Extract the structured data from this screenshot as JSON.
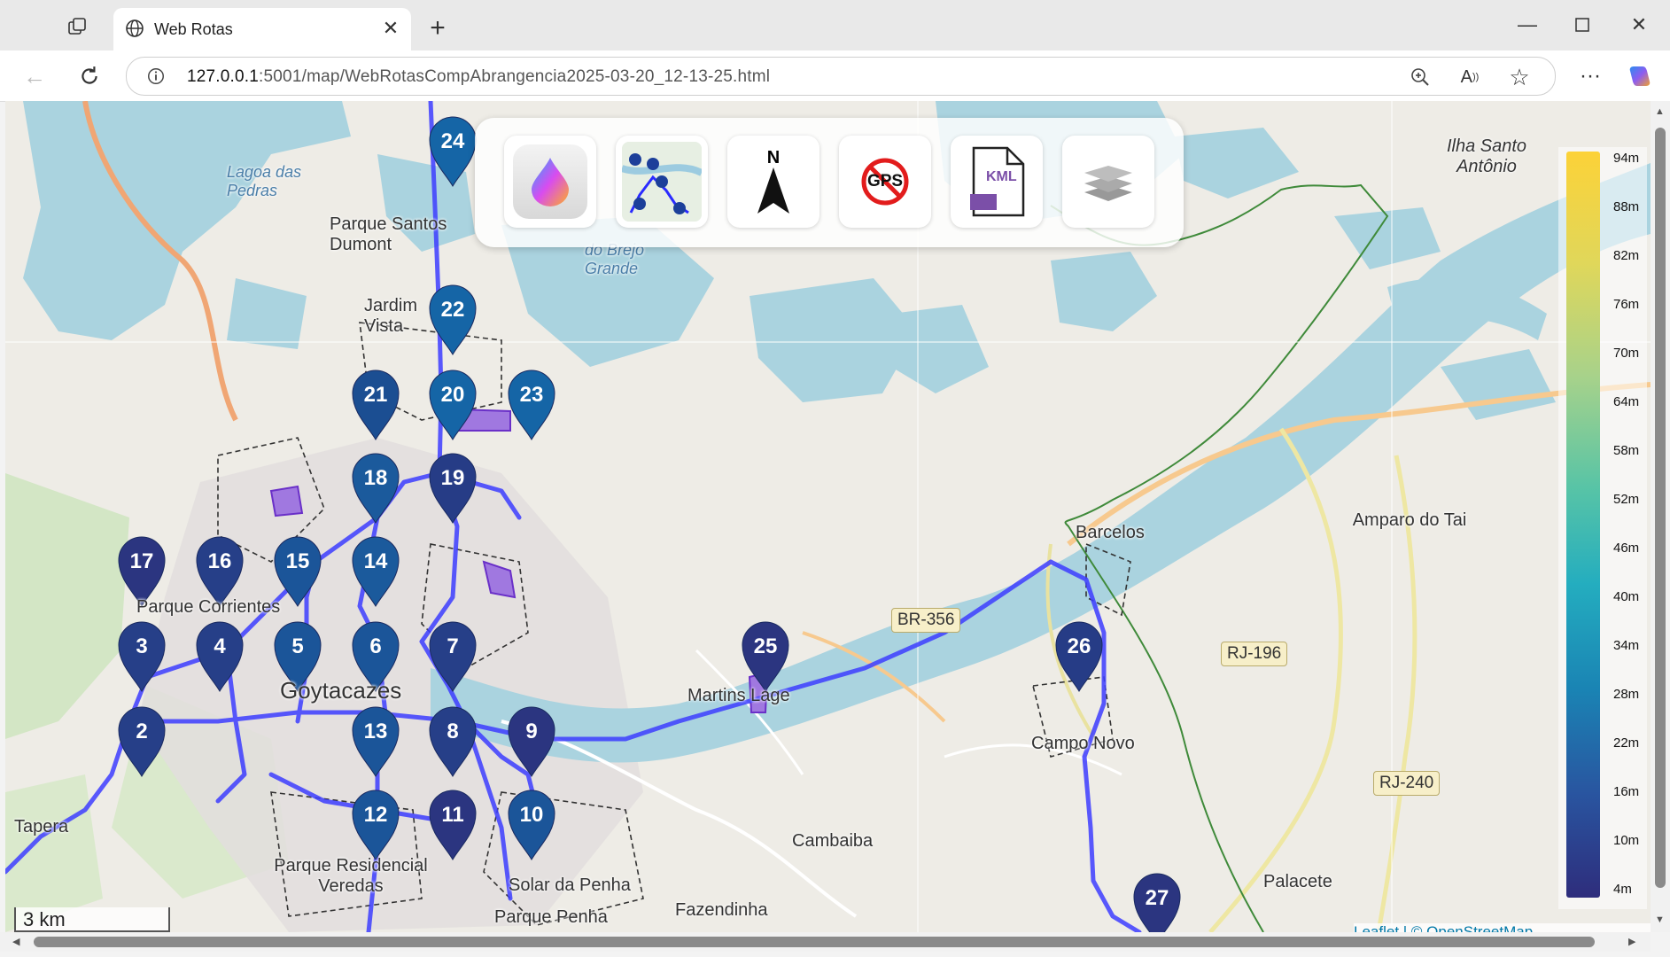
{
  "browser": {
    "tab_title": "Web Rotas",
    "url_host": "127.0.0.1",
    "url_rest": ":5001/map/WebRotasCompAbrangencia2025-03-20_12-13-25.html"
  },
  "map": {
    "controls": [
      "elevation-palette",
      "route-map",
      "north-arrow",
      "gps-off",
      "kml-export",
      "layers"
    ],
    "kml_icon_text": "KML",
    "north_letter": "N",
    "gps_text": "GPS",
    "scale_label": "3 km",
    "attribution": "Leaflet | © OpenStreetMap",
    "legend_labels": [
      "94m",
      "88m",
      "82m",
      "76m",
      "70m",
      "64m",
      "58m",
      "52m",
      "46m",
      "40m",
      "34m",
      "28m",
      "22m",
      "16m",
      "10m",
      "4m"
    ],
    "places": {
      "lagoa_das_pedras": "Lagoa das Pedras",
      "parque_santos_dumont": "Parque Santos Dumont",
      "jardim_vista": "Jardim Vista",
      "brejo_grande": "do Brejo Grande",
      "ilha_santo_antonio": "Ilha Santo Antônio",
      "barcelos": "Barcelos",
      "amparo_do_tai": "Amparo do Tai",
      "martins_lage": "Martins Lage",
      "campo_novo": "Campo Novo",
      "cambaiba": "Cambaiba",
      "palacete": "Palacete",
      "fazendinha": "Fazendinha",
      "parque_penha": "Parque Penha",
      "solar_da_penha": "Solar da Penha",
      "parque_residencial_veredas": "Parque Residencial Veredas",
      "goytacazes": "Goytacazes",
      "parque_corrientes": "Parque Corrientes",
      "tapera": "Tapera",
      "br356": "BR-356",
      "rj196": "RJ-196",
      "rj240": "RJ-240"
    },
    "markers": [
      {
        "n": "24",
        "color": "#1565a6"
      },
      {
        "n": "22",
        "color": "#1565a6"
      },
      {
        "n": "21",
        "color": "#1b4e92"
      },
      {
        "n": "20",
        "color": "#1565a6"
      },
      {
        "n": "23",
        "color": "#1565a6"
      },
      {
        "n": "18",
        "color": "#1b5a9c"
      },
      {
        "n": "19",
        "color": "#263c86"
      },
      {
        "n": "17",
        "color": "#2b3580"
      },
      {
        "n": "16",
        "color": "#263f88"
      },
      {
        "n": "15",
        "color": "#1b5599"
      },
      {
        "n": "14",
        "color": "#1b5a9c"
      },
      {
        "n": "3",
        "color": "#263f88"
      },
      {
        "n": "4",
        "color": "#263f88"
      },
      {
        "n": "5",
        "color": "#1b5599"
      },
      {
        "n": "6",
        "color": "#1b5599"
      },
      {
        "n": "7",
        "color": "#263f88"
      },
      {
        "n": "25",
        "color": "#2b3580"
      },
      {
        "n": "26",
        "color": "#263c86"
      },
      {
        "n": "2",
        "color": "#263f88"
      },
      {
        "n": "13",
        "color": "#1b5599"
      },
      {
        "n": "8",
        "color": "#263f88"
      },
      {
        "n": "9",
        "color": "#2b3580"
      },
      {
        "n": "12",
        "color": "#1b5599"
      },
      {
        "n": "11",
        "color": "#2b3580"
      },
      {
        "n": "10",
        "color": "#1b5599"
      },
      {
        "n": "27",
        "color": "#2b3580"
      }
    ]
  }
}
